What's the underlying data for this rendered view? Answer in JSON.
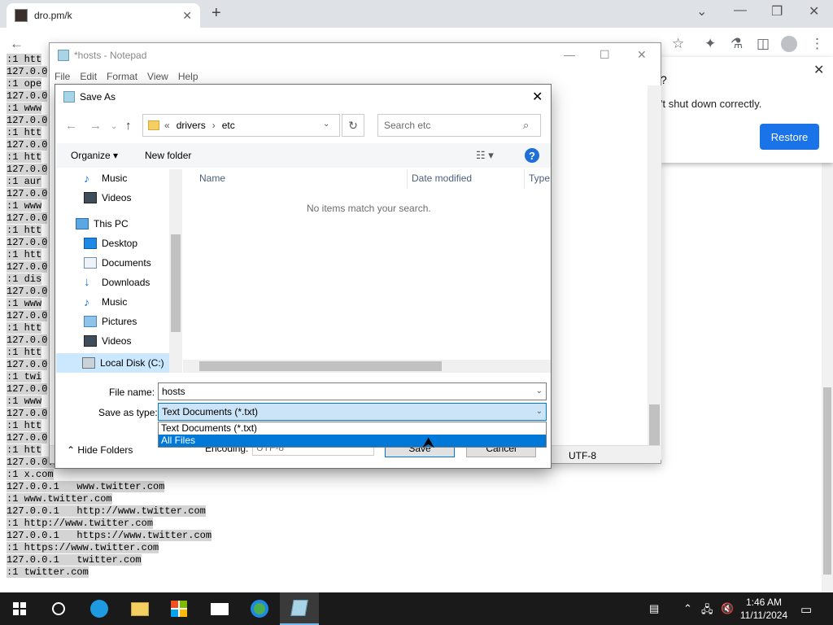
{
  "browser": {
    "tab_title": "dro.pm/k",
    "restore_popup": {
      "title_fragment": "?",
      "message": "'t shut down correctly.",
      "restore_button": "Restore"
    }
  },
  "page": {
    "lines": [
      ":1 htt",
      "127.0.0",
      ":1 ope",
      "127.0.0",
      ":1 www",
      "127.0.0",
      ":1 htt",
      "127.0.0",
      ":1 htt",
      "127.0.0",
      ":1 aur",
      "127.0.0",
      ":1 www",
      "127.0.0",
      ":1 htt",
      "127.0.0",
      ":1 htt",
      "127.0.0",
      ":1 dis",
      "127.0.0",
      ":1 www",
      "127.0.0",
      ":1 htt",
      "127.0.0",
      ":1 htt",
      "127.0.0",
      ":1 twi",
      "127.0.0",
      ":1 www",
      "127.0.0",
      ":1 htt",
      "127.0.0",
      ":1 htt",
      "127.0.0.1   x.com",
      ":1 x.com",
      "127.0.0.1   www.twitter.com",
      ":1 www.twitter.com",
      "127.0.0.1   http://www.twitter.com",
      ":1 http://www.twitter.com",
      "127.0.0.1   https://www.twitter.com",
      ":1 https://www.twitter.com",
      "127.0.0.1   twitter.com",
      ":1 twitter.com"
    ]
  },
  "notepad": {
    "title": "*hosts - Notepad",
    "menu": [
      "File",
      "Edit",
      "Format",
      "View",
      "Help"
    ],
    "status_encoding": "UTF-8"
  },
  "dialog": {
    "title": "Save As",
    "breadcrumb_prefix": "«",
    "breadcrumb": [
      "drivers",
      "etc"
    ],
    "breadcrumb_sep": "›",
    "search_placeholder": "Search etc",
    "organize_label": "Organize ▾",
    "new_folder_label": "New folder",
    "nav_items": [
      {
        "label": "Music",
        "icon": "music-icon"
      },
      {
        "label": "Videos",
        "icon": "videos-icon"
      },
      {
        "label": "This PC",
        "icon": "computer-icon"
      },
      {
        "label": "Desktop",
        "icon": "desktop-icon"
      },
      {
        "label": "Documents",
        "icon": "documents-icon"
      },
      {
        "label": "Downloads",
        "icon": "downloads-icon"
      },
      {
        "label": "Music",
        "icon": "music-icon"
      },
      {
        "label": "Pictures",
        "icon": "pictures-icon"
      },
      {
        "label": "Videos",
        "icon": "videos-icon"
      },
      {
        "label": "Local Disk (C:)",
        "icon": "drive-icon"
      }
    ],
    "columns": [
      "Name",
      "Date modified",
      "Type"
    ],
    "empty_message": "No items match your search.",
    "file_name_label": "File name:",
    "file_name_value": "hosts",
    "save_type_label": "Save as type:",
    "save_type_value": "Text Documents (*.txt)",
    "type_options": [
      "Text Documents (*.txt)",
      "All Files"
    ],
    "hide_folders_label": "Hide Folders",
    "encoding_label": "Encoding:",
    "encoding_value": "UTF-8",
    "save_button": "Save",
    "cancel_button": "Cancel"
  },
  "taskbar": {
    "time": "1:46 AM",
    "date": "11/11/2024"
  }
}
